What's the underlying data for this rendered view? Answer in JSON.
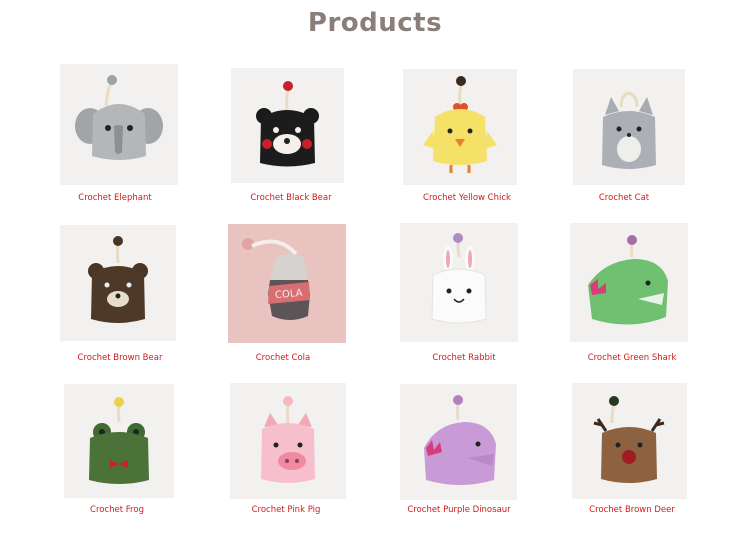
{
  "page": {
    "title": "Products"
  },
  "products": [
    {
      "name": "Crochet Elephant"
    },
    {
      "name": "Crochet Black Bear"
    },
    {
      "name": "Crochet Yellow Chick"
    },
    {
      "name": "Crochet Cat"
    },
    {
      "name": "Crochet Brown Bear"
    },
    {
      "name": "Crochet Cola"
    },
    {
      "name": "Crochet Rabbit"
    },
    {
      "name": "Crochet Green Shark"
    },
    {
      "name": "Crochet Frog"
    },
    {
      "name": "Crochet Pink Pig"
    },
    {
      "name": "Crochet Purple Dinosaur"
    },
    {
      "name": "Crochet Brown Deer"
    }
  ],
  "colors": {
    "title": "#8a7e79",
    "caption": "#d11a1a",
    "photo_bg": "#f2f1ef",
    "cola_bg": "#e9c3c0"
  }
}
